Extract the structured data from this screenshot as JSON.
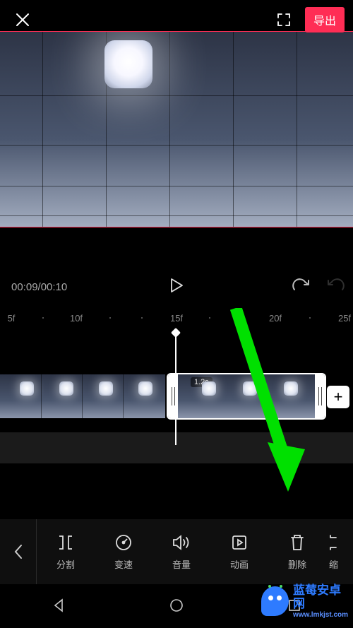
{
  "topbar": {
    "export_label": "导出"
  },
  "playback": {
    "time": "00:09/00:10"
  },
  "ruler": {
    "labels": [
      "5f",
      "10f",
      "15f",
      "20f",
      "25f"
    ]
  },
  "clip": {
    "duration_badge": "1.2s"
  },
  "tools": {
    "items": [
      {
        "key": "split",
        "label": "分割"
      },
      {
        "key": "speed",
        "label": "变速"
      },
      {
        "key": "volume",
        "label": "音量"
      },
      {
        "key": "animate",
        "label": "动画"
      },
      {
        "key": "delete",
        "label": "删除"
      },
      {
        "key": "scale",
        "label": "缩"
      }
    ]
  },
  "watermark": {
    "title": "蓝莓安卓网",
    "url": "www.lmkjst.com"
  }
}
